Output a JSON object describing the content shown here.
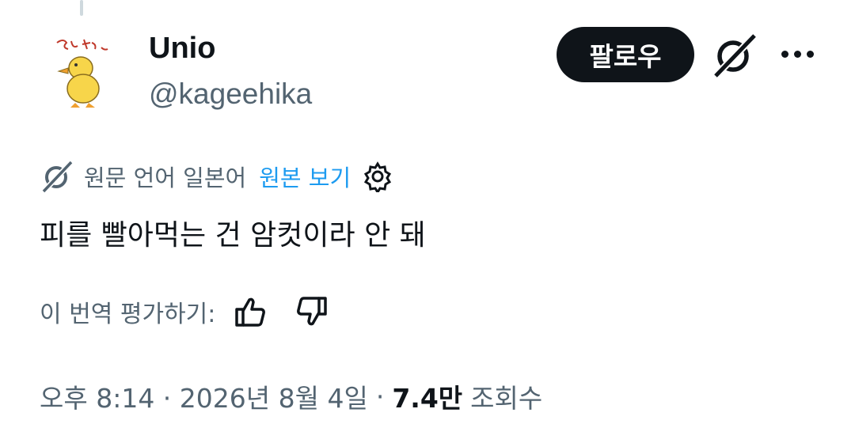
{
  "author": {
    "name": "Unio",
    "handle": "@kageehika",
    "avatar_caption": "とんな。"
  },
  "actions": {
    "follow_label": "팔로우",
    "grok_icon": "grok-icon",
    "more_icon": "more-icon"
  },
  "translation": {
    "source_text": "원문 언어 일본어",
    "show_original_label": "원본 보기",
    "icon": "grok-icon",
    "settings_icon": "gear-icon"
  },
  "tweet": {
    "text": "피를 빨아먹는 건 암컷이라 안 돼"
  },
  "rating": {
    "label": "이 번역 평가하기:",
    "up_icon": "thumbs-up-icon",
    "down_icon": "thumbs-down-icon"
  },
  "meta": {
    "timestamp": "오후 8:14 · 2026년 8월 4일",
    "separator": "·",
    "views_count": "7.4만",
    "views_label": "조회수"
  },
  "colors": {
    "text_primary": "#0f1419",
    "text_secondary": "#536471",
    "link": "#1d9bf0",
    "follow_bg": "#0f1419"
  }
}
